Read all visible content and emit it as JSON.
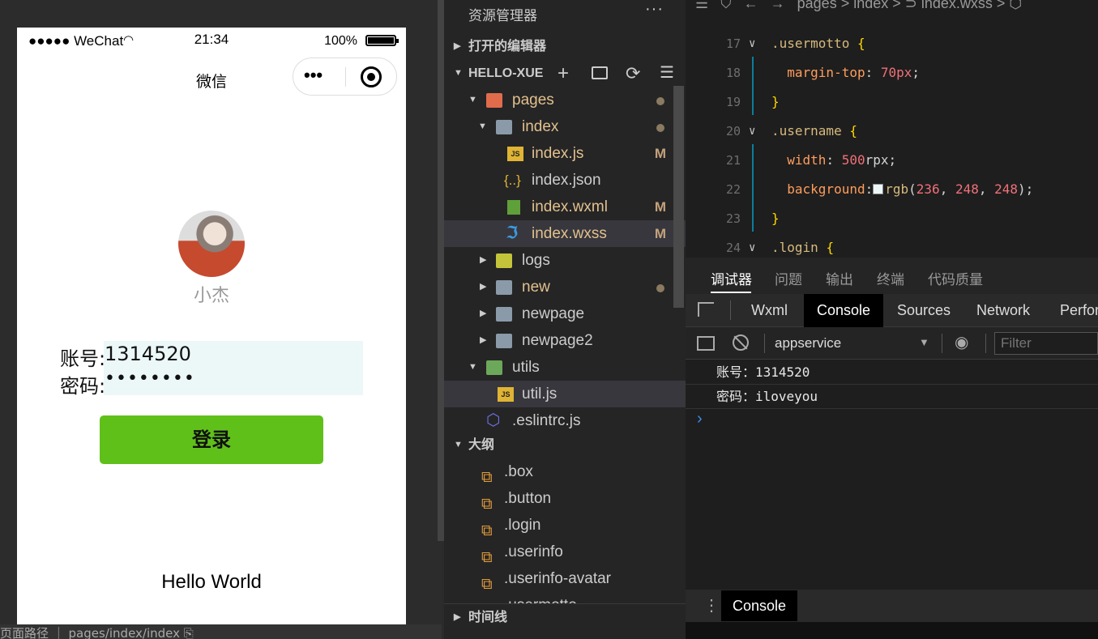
{
  "simulator": {
    "status": {
      "signal": "●●●●● WeChat",
      "time": "21:34",
      "battery_pct": "100%"
    },
    "nav_title": "微信",
    "capsule_more": "•••",
    "nickname": "小杰",
    "account_label": "账号:",
    "account_value": "1314520",
    "password_label": "密码:",
    "password_value": "••••••••",
    "login_button": "登录",
    "hello": "Hello World",
    "bottom_text": "页面路径  ｜  pages/index/index  ⎘"
  },
  "explorer": {
    "title": "资源管理器",
    "more": "···",
    "open_editors": "打开的编辑器",
    "project": "HELLO-XUE",
    "tree": [
      {
        "name": "pages",
        "badge": "",
        "dot": true
      },
      {
        "name": "index",
        "badge": "",
        "dot": true
      },
      {
        "name": "index.js",
        "badge": "M",
        "dot": false
      },
      {
        "name": "index.json",
        "badge": "",
        "dot": false
      },
      {
        "name": "index.wxml",
        "badge": "M",
        "dot": false
      },
      {
        "name": "index.wxss",
        "badge": "M",
        "dot": false
      },
      {
        "name": "logs",
        "badge": "",
        "dot": false
      },
      {
        "name": "new",
        "badge": "",
        "dot": true
      },
      {
        "name": "newpage",
        "badge": "",
        "dot": false
      },
      {
        "name": "newpage2",
        "badge": "",
        "dot": false
      },
      {
        "name": "utils",
        "badge": "",
        "dot": false
      },
      {
        "name": "util.js",
        "badge": "",
        "dot": false
      },
      {
        "name": ".eslintrc.js",
        "badge": "",
        "dot": false
      }
    ],
    "outline_title": "大纲",
    "outline": [
      ".box",
      ".button",
      ".login",
      ".userinfo",
      ".userinfo-avatar",
      ".usermotto"
    ],
    "timeline": "时间线"
  },
  "editor": {
    "breadcrumb": "☰   ⛉   ←   →   pages > index > ⊃ index.wxss > ⬡",
    "lines": [
      {
        "n": "17",
        "parts": [
          [
            "sel-c",
            ".usermotto "
          ],
          [
            "brace",
            "{"
          ]
        ]
      },
      {
        "n": "18",
        "parts": [
          [
            "prop",
            "  margin-top"
          ],
          [
            "plain",
            ": "
          ],
          [
            "num",
            "70px"
          ],
          [
            "plain",
            ";"
          ]
        ]
      },
      {
        "n": "19",
        "parts": [
          [
            "brace",
            "}"
          ]
        ]
      },
      {
        "n": "20",
        "parts": [
          [
            "sel-c",
            ".username "
          ],
          [
            "brace",
            "{"
          ]
        ]
      },
      {
        "n": "21",
        "parts": [
          [
            "prop",
            "  width"
          ],
          [
            "plain",
            ": "
          ],
          [
            "num",
            "500"
          ],
          [
            "plain",
            "rpx;"
          ]
        ]
      },
      {
        "n": "22",
        "parts": [
          [
            "prop",
            "  background"
          ],
          [
            "plain",
            ":"
          ],
          [
            "swatch",
            ""
          ],
          [
            "sel-c",
            "rgb"
          ],
          [
            "plain",
            "("
          ],
          [
            "num",
            "236"
          ],
          [
            "plain",
            ", "
          ],
          [
            "num",
            "248"
          ],
          [
            "plain",
            ", "
          ],
          [
            "num",
            "248"
          ],
          [
            "plain",
            ");"
          ]
        ]
      },
      {
        "n": "23",
        "parts": [
          [
            "brace",
            "}"
          ]
        ]
      },
      {
        "n": "24",
        "parts": [
          [
            "sel-c",
            ".login "
          ],
          [
            "brace",
            "{"
          ]
        ]
      }
    ]
  },
  "devtools": {
    "tabs": [
      "调试器",
      "问题",
      "输出",
      "终端",
      "代码质量"
    ],
    "tool_tabs": [
      "Wxml",
      "Console",
      "Sources",
      "Network",
      "Perfor"
    ],
    "context": "appservice",
    "filter_placeholder": "Filter",
    "logs": [
      "账号：1314520",
      "密码：iloveyou"
    ],
    "prompt": "›",
    "drawer_tab": "Console"
  }
}
